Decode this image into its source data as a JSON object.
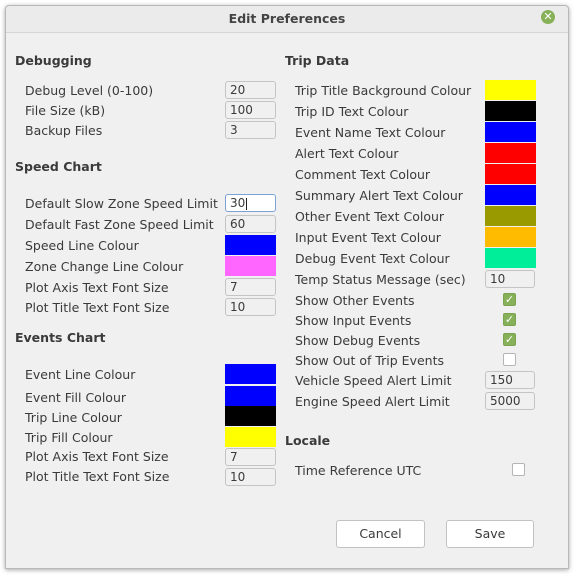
{
  "window": {
    "title": "Edit Preferences",
    "close_icon": "close-icon"
  },
  "debugging": {
    "header": "Debugging",
    "debug_level_label": "Debug Level (0-100)",
    "debug_level_value": "20",
    "file_size_label": "File Size (kB)",
    "file_size_value": "100",
    "backup_files_label": "Backup Files",
    "backup_files_value": "3"
  },
  "speed_chart": {
    "header": "Speed Chart",
    "slow_zone_label": "Default Slow Zone Speed Limit",
    "slow_zone_value": "30",
    "fast_zone_label": "Default Fast Zone Speed Limit",
    "fast_zone_value": "60",
    "speed_line_label": "Speed Line Colour",
    "speed_line_color": "#0000ff",
    "zone_change_label": "Zone Change Line  Colour",
    "zone_change_color": "#ff66ff",
    "axis_font_label": "Plot Axis Text Font Size",
    "axis_font_value": "7",
    "title_font_label": "Plot Title Text Font Size",
    "title_font_value": "10"
  },
  "events_chart": {
    "header": "Events Chart",
    "event_line_label": "Event Line Colour",
    "event_line_color": "#0000ff",
    "event_fill_label": "Event Fill Colour",
    "event_fill_color": "#0000ff",
    "trip_line_label": "Trip Line  Colour",
    "trip_line_color": "#000000",
    "trip_fill_label": "Trip Fill  Colour",
    "trip_fill_color": "#ffff00",
    "axis_font_label": "Plot Axis Text Font Size",
    "axis_font_value": "7",
    "title_font_label": "Plot Title Text Font Size",
    "title_font_value": "10"
  },
  "trip_data": {
    "header": "Trip Data",
    "title_bg_label": "Trip Title Background Colour",
    "title_bg_color": "#ffff00",
    "trip_id_label": "Trip ID Text Colour",
    "trip_id_color": "#000000",
    "event_name_label": "Event Name Text Colour",
    "event_name_color": "#0000ff",
    "alert_text_label": "Alert Text Colour",
    "alert_text_color": "#ff0000",
    "comment_text_label": "Comment Text Colour",
    "comment_text_color": "#ff0000",
    "summary_alert_label": "Summary Alert Text Colour",
    "summary_alert_color": "#0000ff",
    "other_event_label": "Other Event Text Colour",
    "other_event_color": "#999900",
    "input_event_label": "Input Event Text Colour",
    "input_event_color": "#ffbb00",
    "debug_event_label": "Debug Event Text Colour",
    "debug_event_color": "#00ee99",
    "temp_status_label": "Temp Status Message (sec)",
    "temp_status_value": "10",
    "show_other_label": "Show Other Events",
    "show_other_checked": true,
    "show_input_label": "Show Input Events",
    "show_input_checked": true,
    "show_debug_label": "Show Debug Events",
    "show_debug_checked": true,
    "show_out_label": "Show Out of Trip Events",
    "show_out_checked": false,
    "vehicle_alert_label": "Vehicle Speed Alert Limit",
    "vehicle_alert_value": "150",
    "engine_alert_label": "Engine Speed Alert Limit",
    "engine_alert_value": "5000"
  },
  "locale": {
    "header": "Locale",
    "utc_label": "Time Reference UTC",
    "utc_checked": false
  },
  "buttons": {
    "cancel": "Cancel",
    "save": "Save"
  },
  "colors": {
    "check_accent": "#87b158"
  }
}
